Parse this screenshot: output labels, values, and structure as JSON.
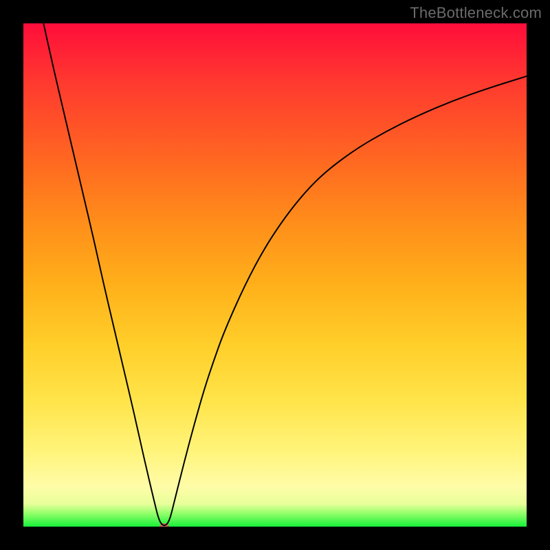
{
  "watermark": "TheBottleneck.com",
  "chart_data": {
    "type": "line",
    "title": "",
    "xlabel": "",
    "ylabel": "",
    "xlim": [
      0,
      100
    ],
    "ylim": [
      0,
      100
    ],
    "grid": false,
    "legend": false,
    "background_gradient": {
      "top_color": "#ff0d3a",
      "mid_color": "#ffcf2a",
      "bottom_color": "#16ef39"
    },
    "series": [
      {
        "name": "bottleneck-curve",
        "color": "#000000",
        "stroke_width": 2,
        "x": [
          4,
          6,
          8,
          10,
          12,
          14,
          16,
          18,
          20,
          22,
          24,
          26,
          27,
          28,
          29,
          30,
          32,
          34,
          36,
          38,
          40,
          44,
          48,
          52,
          56,
          60,
          66,
          72,
          78,
          85,
          92,
          100
        ],
        "y": [
          100,
          91,
          82.5,
          74,
          65.5,
          57,
          48,
          39.5,
          31,
          22.5,
          13.5,
          5,
          1,
          0,
          1,
          5,
          13,
          20.5,
          27.5,
          33.5,
          39,
          48,
          55.5,
          61.5,
          66.5,
          70.5,
          75,
          78.5,
          81.5,
          84.5,
          87,
          89.5
        ]
      }
    ],
    "marker": {
      "name": "minimum-marker",
      "x": 28,
      "y": 0,
      "color": "#d46a5f",
      "rx": 7,
      "ry": 5
    }
  }
}
